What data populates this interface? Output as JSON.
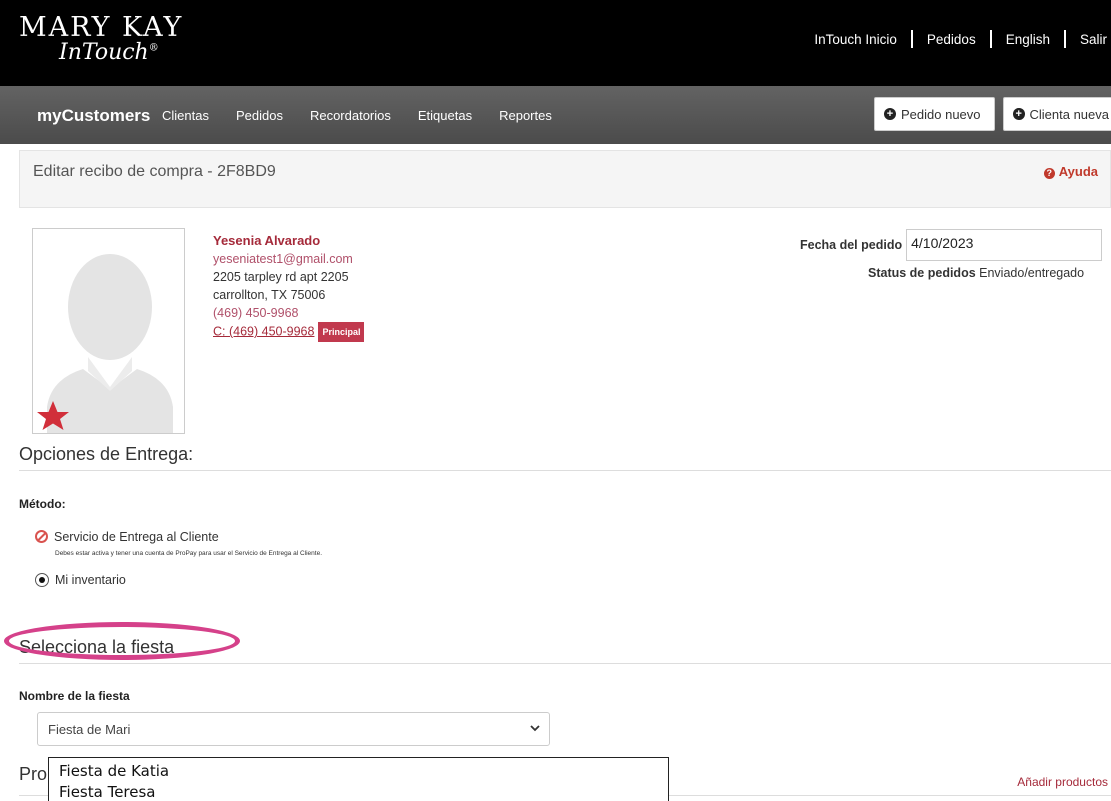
{
  "brand": {
    "logo_main": "MARY KAY",
    "logo_sub": "InTouch",
    "logo_mark": "®"
  },
  "top_links": [
    "InTouch Inicio",
    "Pedidos",
    "English",
    "Salir"
  ],
  "nav": {
    "brand": "myCustomers",
    "items": [
      "Clientas",
      "Pedidos",
      "Recordatorios",
      "Etiquetas",
      "Reportes"
    ],
    "new_order": "Pedido nuevo",
    "new_customer": "Clienta nueva"
  },
  "page": {
    "title": "Editar recibo de compra  - 2F8BD9",
    "help": "Ayuda"
  },
  "customer": {
    "name": "Yesenia Alvarado",
    "email": "yeseniatest1@gmail.com",
    "address1": "2205 tarpley rd apt 2205",
    "address2": "carrollton, TX 75006",
    "phone": "(469) 450-9968",
    "cell": "C: (469) 450-9968",
    "badge": "Principal"
  },
  "order": {
    "date_label": "Fecha del pedido",
    "date_value": "4/10/2023",
    "status_label": "Status de pedidos",
    "status_value": "Enviado/entregado"
  },
  "delivery": {
    "heading": "Opciones de Entrega:",
    "method_label": "Método:",
    "option1": "Servicio de Entrega al Cliente",
    "option1_note": "Debes estar activa y tener una cuenta de ProPay para usar el Servicio de Entrega al Cliente.",
    "option2": "Mi inventario"
  },
  "party": {
    "heading": "Selecciona la fiesta",
    "name_label": "Nombre de la fiesta",
    "selected": "Fiesta de Mari",
    "options": [
      "Fiesta de Katia",
      "Fiesta Teresa"
    ]
  },
  "products": {
    "heading_partial": "Pro",
    "add_link": "Añadir productos"
  },
  "colors": {
    "accent": "#a52a3a",
    "highlight": "#d5418a",
    "topbar": "#000000",
    "navbar": "#555555"
  }
}
